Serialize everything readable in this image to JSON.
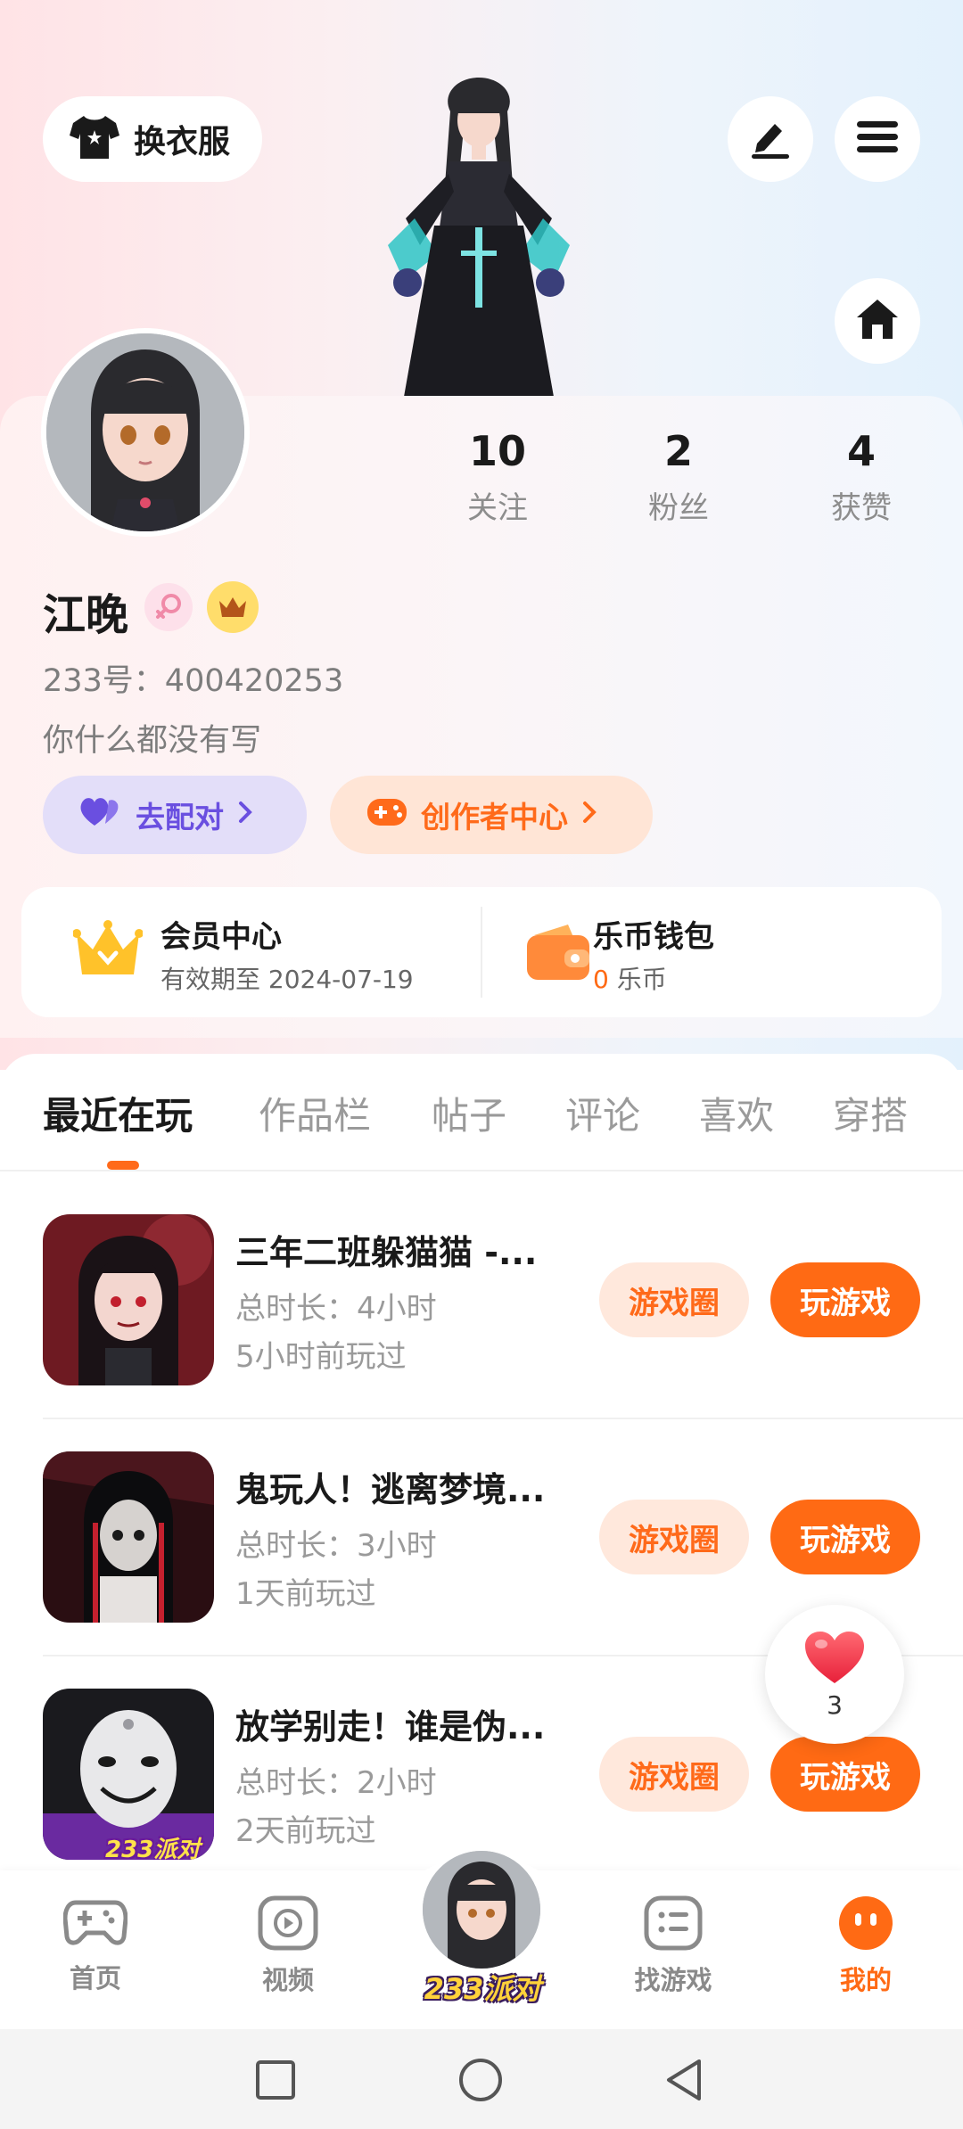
{
  "header": {
    "dressup_label": "换衣服"
  },
  "profile": {
    "username": "江晚",
    "uid_text": "233号：400420253",
    "bio": "你什么都没有写",
    "stats": [
      {
        "num": "10",
        "label": "关注"
      },
      {
        "num": "2",
        "label": "粉丝"
      },
      {
        "num": "4",
        "label": "获赞"
      }
    ],
    "match_label": "去配对",
    "creator_label": "创作者中心"
  },
  "cards": {
    "vip_title": "会员中心",
    "vip_sub": "有效期至 2024-07-19",
    "wallet_title": "乐币钱包",
    "wallet_amount": "0",
    "wallet_unit": " 乐币"
  },
  "tabs": [
    "最近在玩",
    "作品栏",
    "帖子",
    "评论",
    "喜欢",
    "穿搭"
  ],
  "games": [
    {
      "title": "三年二班躲猫猫 -...",
      "duration": "总时长：4小时",
      "last_played": "5小时前玩过",
      "circle_label": "游戏圈",
      "play_label": "玩游戏"
    },
    {
      "title": "鬼玩人！逃离梦境...",
      "duration": "总时长：3小时",
      "last_played": "1天前玩过",
      "circle_label": "游戏圈",
      "play_label": "玩游戏"
    },
    {
      "title": "放学别走！谁是伪...",
      "duration": "总时长：2小时",
      "last_played": "2天前玩过",
      "circle_label": "游戏圈",
      "play_label": "玩游戏",
      "thumb_badge": "233派对"
    }
  ],
  "floating_like": {
    "count": "3"
  },
  "bottom_nav": {
    "items": [
      "首页",
      "视频",
      "找游戏",
      "我的"
    ],
    "center_label": "233派对",
    "active": "我的"
  },
  "colors": {
    "accent": "#ff6a14",
    "match_purple": "#6a4fe0"
  }
}
